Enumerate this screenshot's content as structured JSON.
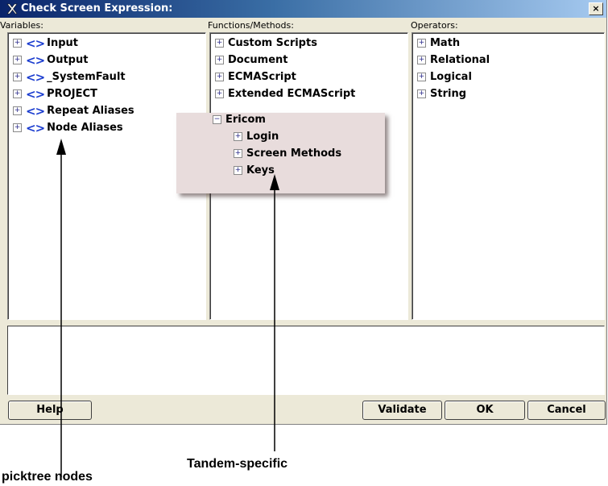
{
  "window": {
    "title": "Check Screen Expression:",
    "close_label": "×"
  },
  "columns": {
    "variables_label": "Variables:",
    "functions_label": "Functions/Methods:",
    "operators_label": "Operators:"
  },
  "variables": [
    {
      "label": "Input",
      "expander": "+",
      "icon": "variable-icon"
    },
    {
      "label": "Output",
      "expander": "+",
      "icon": "variable-icon"
    },
    {
      "label": "_SystemFault",
      "expander": "+",
      "icon": "variable-icon"
    },
    {
      "label": "PROJECT",
      "expander": "+",
      "icon": "variable-icon"
    },
    {
      "label": "Repeat Aliases",
      "expander": "+",
      "icon": "variable-icon"
    },
    {
      "label": "Node Aliases",
      "expander": "+",
      "icon": "variable-icon"
    }
  ],
  "variable_icon_glyph": "<>",
  "functions": [
    {
      "label": "Custom Scripts",
      "expander": "+"
    },
    {
      "label": "Document",
      "expander": "+"
    },
    {
      "label": "ECMAScript",
      "expander": "+"
    },
    {
      "label": "Extended ECMAScript",
      "expander": "+"
    }
  ],
  "ericom": {
    "label": "Ericom",
    "expander": "−",
    "children": [
      {
        "label": "Login",
        "expander": "+"
      },
      {
        "label": "Screen Methods",
        "expander": "+"
      },
      {
        "label": "Keys",
        "expander": "+"
      }
    ]
  },
  "operators": [
    {
      "label": "Math",
      "expander": "+"
    },
    {
      "label": "Relational",
      "expander": "+"
    },
    {
      "label": "Logical",
      "expander": "+"
    },
    {
      "label": "String",
      "expander": "+"
    }
  ],
  "expression": {
    "value": ""
  },
  "buttons": {
    "help": "Help",
    "validate": "Validate",
    "ok": "OK",
    "cancel": "Cancel"
  },
  "annotations": {
    "picktree": "picktree nodes",
    "tandem": "Tandem-specific"
  },
  "colors": {
    "title_bar_start": "#0a246a",
    "title_bar_end": "#a6caf0",
    "dialog_bg": "#ece9d8",
    "variable_icon": "#1a3ccf",
    "popup_bg": "#e8dcdc"
  }
}
